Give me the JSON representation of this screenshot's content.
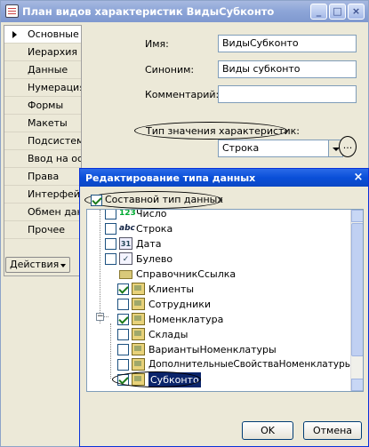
{
  "window": {
    "title": "План видов характеристик ВидыСубконто"
  },
  "nav": {
    "items": [
      "Основные",
      "Иерархия",
      "Данные",
      "Нумерация",
      "Формы",
      "Макеты",
      "Подсистемы",
      "Ввод на основании",
      "Права",
      "Интерфейсы",
      "Обмен данными",
      "Прочее"
    ],
    "actions_label": "Действия"
  },
  "form": {
    "name_label": "Имя:",
    "name_value": "ВидыСубконто",
    "synonym_label": "Синоним:",
    "synonym_value": "Виды субконто",
    "comment_label": "Комментарий:",
    "comment_value": "",
    "type_label": "Тип значения характеристик:",
    "type_value": "Строка",
    "ellipsis": "..."
  },
  "dialog": {
    "title": "Редактирование типа данных",
    "close": "×",
    "composite_label": "Составной тип данных",
    "composite_checked": true,
    "ok_label": "OK",
    "cancel_label": "Отмена",
    "tree": [
      {
        "label": "Число",
        "icon": "number-icon",
        "checked": false
      },
      {
        "label": "Строка",
        "icon": "string-icon",
        "checked": false
      },
      {
        "label": "Дата",
        "icon": "date-icon",
        "checked": false
      },
      {
        "label": "Булево",
        "icon": "boolean-icon",
        "checked": false
      },
      {
        "label": "СправочникСсылка",
        "icon": "folder-icon",
        "checked": null
      },
      {
        "label": "Клиенты",
        "icon": "catalog-icon",
        "checked": true
      },
      {
        "label": "Сотрудники",
        "icon": "catalog-icon",
        "checked": false
      },
      {
        "label": "Номенклатура",
        "icon": "catalog-icon",
        "checked": true
      },
      {
        "label": "Склады",
        "icon": "catalog-icon",
        "checked": false
      },
      {
        "label": "ВариантыНоменклатуры",
        "icon": "catalog-icon",
        "checked": false
      },
      {
        "label": "ДополнительныеСвойстваНоменклатуры",
        "icon": "catalog-icon",
        "checked": false
      },
      {
        "label": "Субконто",
        "icon": "catalog-icon",
        "checked": true
      }
    ]
  }
}
